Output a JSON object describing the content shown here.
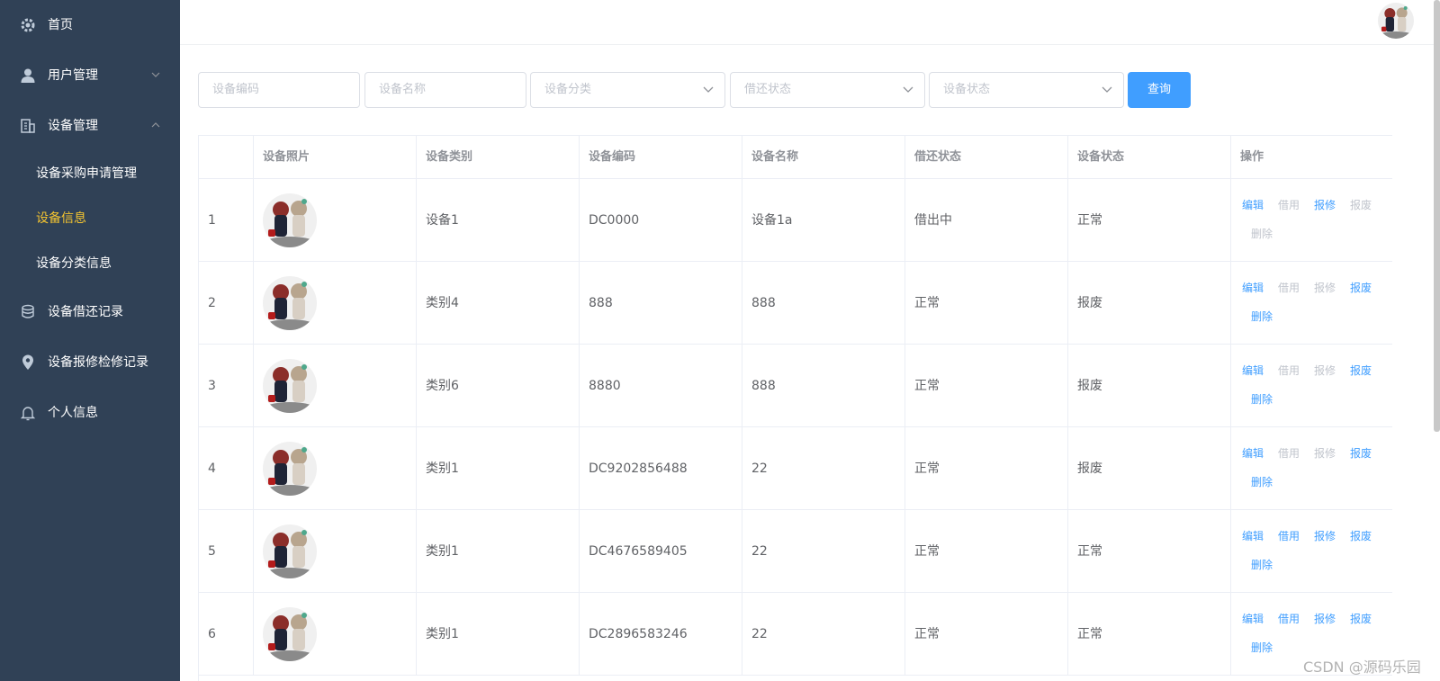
{
  "sidebar": {
    "items": [
      {
        "label": "首页"
      },
      {
        "label": "用户管理"
      },
      {
        "label": "设备管理"
      },
      {
        "label": "设备借还记录"
      },
      {
        "label": "设备报修检修记录"
      },
      {
        "label": "个人信息"
      }
    ],
    "sub_items": [
      {
        "label": "设备采购申请管理"
      },
      {
        "label": "设备信息"
      },
      {
        "label": "设备分类信息"
      }
    ],
    "active_sub": "设备信息",
    "colors": {
      "bg": "#304156",
      "active": "#f4c430"
    }
  },
  "filters": {
    "code_placeholder": "设备编码",
    "name_placeholder": "设备名称",
    "category_placeholder": "设备分类",
    "borrow_placeholder": "借还状态",
    "status_placeholder": "设备状态",
    "search_label": "查询"
  },
  "table": {
    "headers": [
      "",
      "设备照片",
      "设备类别",
      "设备编码",
      "设备名称",
      "借还状态",
      "设备状态",
      "操作"
    ],
    "actions": [
      "编辑",
      "借用",
      "报修",
      "报废",
      "删除"
    ],
    "rows": [
      {
        "index": "1",
        "category": "设备1",
        "code": "DC0000",
        "name": "设备1a",
        "borrow": "借出中",
        "status": "正常",
        "enabled": [
          true,
          false,
          true,
          false,
          false
        ]
      },
      {
        "index": "2",
        "category": "类别4",
        "code": "888",
        "name": "888",
        "borrow": "正常",
        "status": "报废",
        "enabled": [
          true,
          false,
          false,
          true,
          true
        ]
      },
      {
        "index": "3",
        "category": "类别6",
        "code": "8880",
        "name": "888",
        "borrow": "正常",
        "status": "报废",
        "enabled": [
          true,
          false,
          false,
          true,
          true
        ]
      },
      {
        "index": "4",
        "category": "类别1",
        "code": "DC9202856488",
        "name": "22",
        "borrow": "正常",
        "status": "报废",
        "enabled": [
          true,
          false,
          false,
          true,
          true
        ]
      },
      {
        "index": "5",
        "category": "类别1",
        "code": "DC4676589405",
        "name": "22",
        "borrow": "正常",
        "status": "正常",
        "enabled": [
          true,
          true,
          true,
          true,
          true
        ]
      },
      {
        "index": "6",
        "category": "类别1",
        "code": "DC2896583246",
        "name": "22",
        "borrow": "正常",
        "status": "正常",
        "enabled": [
          true,
          true,
          true,
          true,
          true
        ]
      }
    ],
    "colors": {
      "link": "#409eff",
      "disabled": "#c0c4cc"
    }
  },
  "watermark": "CSDN @源码乐园"
}
